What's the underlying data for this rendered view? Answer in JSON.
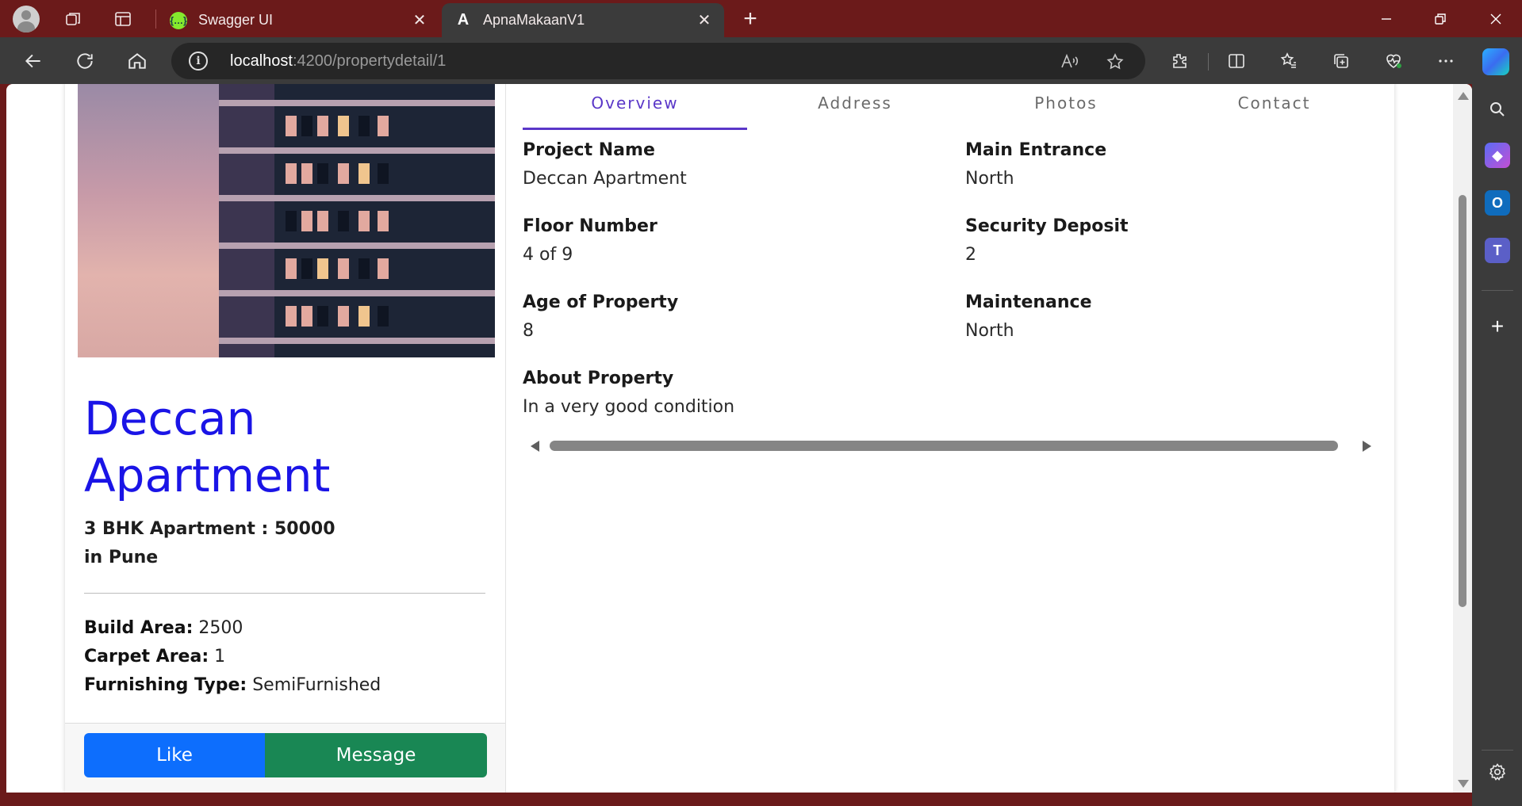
{
  "browser": {
    "tabs": [
      {
        "title": "Swagger UI",
        "favicon": "swagger-icon",
        "favicon_glyph": "{…}",
        "active": false
      },
      {
        "title": "ApnaMakaanV1",
        "favicon": "angular-icon",
        "favicon_glyph": "A",
        "active": true
      }
    ],
    "url": {
      "host": "localhost",
      "rest": ":4200/propertydetail/1"
    },
    "colors": {
      "frame": "#6b1a1a",
      "toolbar": "#3b3b3b",
      "urlbar": "#262626"
    }
  },
  "property": {
    "title": "Deccan Apartment",
    "title_line1": "Deccan",
    "title_line2": "Apartment",
    "subtitle_line1": "3 BHK Apartment : 50000",
    "subtitle_line2": "in Pune",
    "specs": [
      {
        "label": "Build Area:",
        "value": "2500"
      },
      {
        "label": "Carpet Area:",
        "value": "1"
      },
      {
        "label": "Furnishing Type:",
        "value": "SemiFurnished"
      }
    ],
    "buttons": {
      "like": "Like",
      "message": "Message"
    }
  },
  "detail_tabs": [
    "Overview",
    "Address",
    "Photos",
    "Contact"
  ],
  "active_tab": "Overview",
  "overview": {
    "project_name": {
      "label": "Project Name",
      "value": "Deccan Apartment"
    },
    "main_entrance": {
      "label": "Main Entrance",
      "value": "North"
    },
    "floor_number": {
      "label": "Floor Number",
      "value": "4 of 9"
    },
    "security_deposit": {
      "label": "Security Deposit",
      "value": "2"
    },
    "age_of_property": {
      "label": "Age of Property",
      "value": "8"
    },
    "maintenance": {
      "label": "Maintenance",
      "value": "North"
    },
    "about_property": {
      "label": "About Property",
      "value": "In a very good condition"
    }
  },
  "colors": {
    "title": "#1a14e6",
    "like_button": "#0d6efd",
    "message_button": "#198754",
    "active_tab": "#5a37c8"
  }
}
